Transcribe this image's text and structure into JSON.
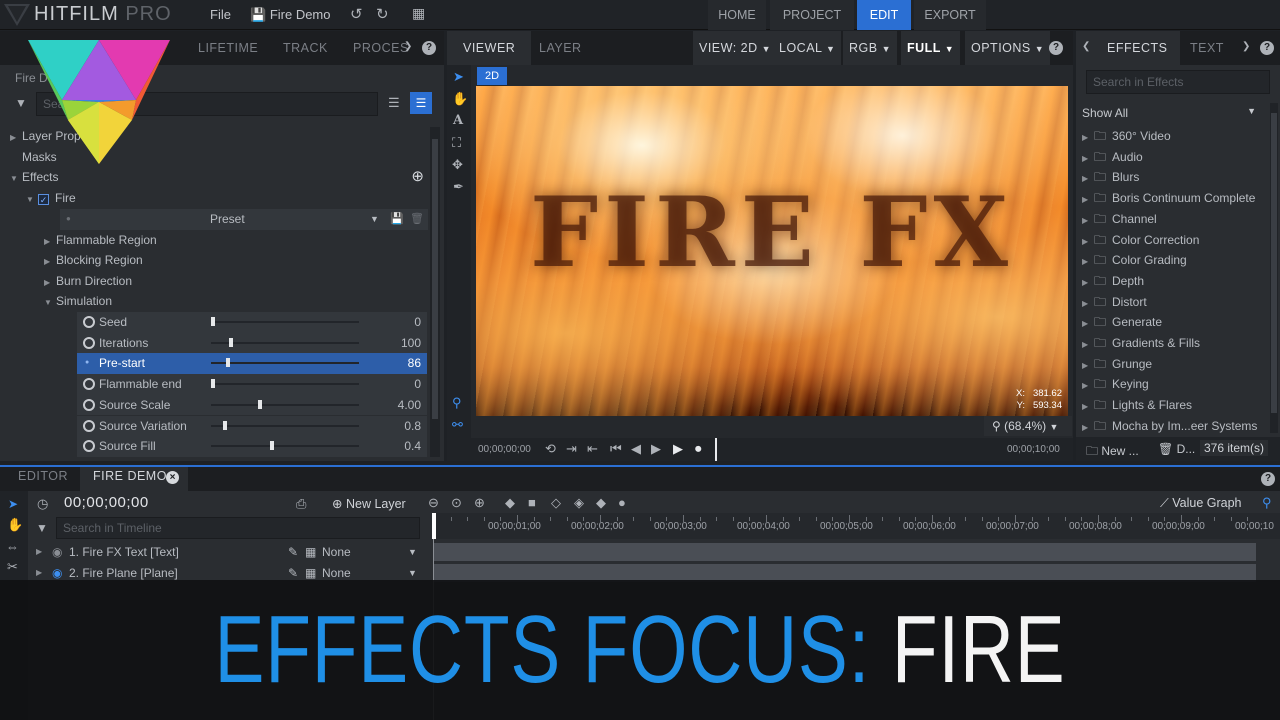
{
  "app": {
    "brand_main": "HITFILM",
    "brand_pro": "PRO",
    "menu_file": "File",
    "project_name": "Fire Demo"
  },
  "nav": {
    "home": "HOME",
    "project": "PROJECT",
    "edit": "EDIT",
    "export": "EXPORT"
  },
  "left_panel": {
    "tabs": [
      "LIFETIME",
      "TRACK",
      "PROCES"
    ],
    "breadcrumb": "Fire Demo",
    "search_placeholder": "Search controls",
    "tree": {
      "layer_props": "Layer Properties",
      "masks": "Masks",
      "effects": "Effects",
      "fire": "Fire",
      "preset": "Preset",
      "flammable_region": "Flammable Region",
      "blocking_region": "Blocking Region",
      "burn_direction": "Burn Direction",
      "simulation": "Simulation"
    },
    "params": [
      {
        "label": "Seed",
        "value": "0",
        "level": 0.0
      },
      {
        "label": "Iterations",
        "value": "100",
        "level": 0.12
      },
      {
        "label": "Pre-start",
        "value": "86",
        "level": 0.1
      },
      {
        "label": "Flammable end",
        "value": "0",
        "level": 0.0
      },
      {
        "label": "Source Scale",
        "value": "4.00",
        "level": 0.32
      },
      {
        "label": "Source Variation",
        "value": "0.8",
        "level": 0.08
      },
      {
        "label": "Source Fill",
        "value": "0.4",
        "level": 0.4
      }
    ]
  },
  "viewer": {
    "tabs": {
      "viewer": "VIEWER",
      "layer": "LAYER"
    },
    "controls": {
      "view": "VIEW: 2D",
      "local": "LOCAL",
      "rgb": "RGB",
      "full": "FULL",
      "options": "OPTIONS"
    },
    "badge_2d": "2D",
    "canvas_text": "FIRE FX",
    "coord_x_label": "X:",
    "coord_x": "381.62",
    "coord_y_label": "Y:",
    "coord_y": "593.34",
    "zoom": "(68.4%)",
    "time_start": "00;00;00;00",
    "time_end": "00;00;10;00"
  },
  "effects_panel": {
    "tabs": {
      "effects": "EFFECTS",
      "text": "TEXT"
    },
    "search_placeholder": "Search in Effects",
    "filter": "Show All",
    "folders": [
      "360° Video",
      "Audio",
      "Blurs",
      "Boris Continuum Complete",
      "Channel",
      "Color Correction",
      "Color Grading",
      "Depth",
      "Distort",
      "Generate",
      "Gradients & Fills",
      "Grunge",
      "Keying",
      "Lights & Flares",
      "Mocha by Im...eer Systems"
    ],
    "new_label": "New ...",
    "delete_label": "D...",
    "count": "376 item(s)"
  },
  "timeline": {
    "tabs": {
      "editor": "EDITOR",
      "fire_demo": "FIRE DEMO"
    },
    "timecode": "00;00;00;00",
    "new_layer": "New Layer",
    "value_graph": "Value Graph",
    "search_placeholder": "Search in Timeline",
    "ruler": [
      "00;00;01;00",
      "00;00;02;00",
      "00;00;03;00",
      "00;00;04;00",
      "00;00;05;00",
      "00;00;06;00",
      "00;00;07;00",
      "00;00;08;00",
      "00;00;09;00",
      "00;00;10"
    ],
    "layers": [
      {
        "name": "1. Fire FX Text [Text]",
        "blend": "None"
      },
      {
        "name": "2. Fire Plane [Plane]",
        "blend": "None"
      }
    ]
  },
  "banner": {
    "part1": "EFFECTS FOCUS: ",
    "part2": "FIRE"
  },
  "colors": {
    "accent": "#2b6fd3",
    "banner_blue": "#1f8fe6"
  }
}
